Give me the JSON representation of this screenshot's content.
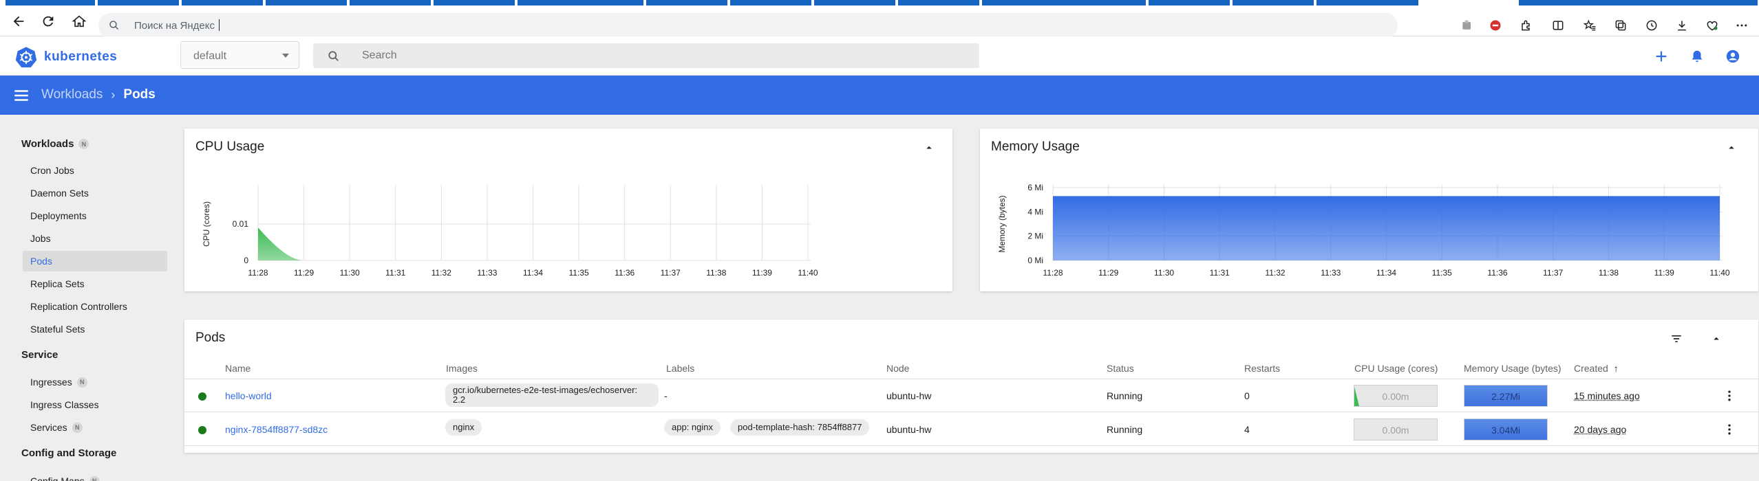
{
  "browser": {
    "address_placeholder": "Поиск на Яндекс"
  },
  "header": {
    "logo_text": "kubernetes",
    "namespace": "default",
    "search_placeholder": "Search"
  },
  "toolbar": {
    "breadcrumb_parent": "Workloads",
    "breadcrumb_separator": "›",
    "breadcrumb_current": "Pods"
  },
  "sidebar": {
    "sections": [
      {
        "label": "Workloads",
        "badge": "N"
      },
      {
        "label": "Service"
      },
      {
        "label": "Config and Storage"
      }
    ],
    "workloads_items": [
      "Cron Jobs",
      "Daemon Sets",
      "Deployments",
      "Jobs",
      "Pods",
      "Replica Sets",
      "Replication Controllers",
      "Stateful Sets"
    ],
    "service_items": [
      {
        "label": "Ingresses",
        "badge": "N"
      },
      {
        "label": "Ingress Classes"
      },
      {
        "label": "Services",
        "badge": "N"
      }
    ],
    "config_items": [
      {
        "label": "Config Maps",
        "badge": "N"
      }
    ],
    "active": "Pods"
  },
  "cpu_card": {
    "title": "CPU Usage"
  },
  "memory_card": {
    "title": "Memory Usage"
  },
  "chart_data": [
    {
      "type": "area",
      "title": "CPU Usage",
      "ylabel": "CPU (cores)",
      "x": [
        "11:28",
        "11:29",
        "11:30",
        "11:31",
        "11:32",
        "11:33",
        "11:34",
        "11:35",
        "11:36",
        "11:37",
        "11:38",
        "11:39",
        "11:40"
      ],
      "y_ticks": [
        "0.01",
        "0"
      ],
      "ylim": [
        0,
        0.02
      ],
      "series": [
        {
          "values": [
            0.009,
            0,
            0,
            0,
            0,
            0,
            0,
            0,
            0,
            0,
            0,
            0,
            0
          ],
          "color": "#3cba54"
        }
      ],
      "grid": true
    },
    {
      "type": "area",
      "title": "Memory Usage",
      "ylabel": "Memory (bytes)",
      "x": [
        "11:28",
        "11:29",
        "11:30",
        "11:31",
        "11:32",
        "11:33",
        "11:34",
        "11:35",
        "11:36",
        "11:37",
        "11:38",
        "11:39",
        "11:40"
      ],
      "y_ticks": [
        "6 Mi",
        "4 Mi",
        "2 Mi",
        "0 Mi"
      ],
      "ylim": [
        0,
        6
      ],
      "series": [
        {
          "values": [
            5.3,
            5.3,
            5.3,
            5.3,
            5.3,
            5.3,
            5.3,
            5.3,
            5.3,
            5.3,
            5.3,
            5.3,
            5.3
          ],
          "color": "#326ce5"
        }
      ],
      "grid": true
    }
  ],
  "pods": {
    "title": "Pods",
    "columns": [
      "Name",
      "Images",
      "Labels",
      "Node",
      "Status",
      "Restarts",
      "CPU Usage (cores)",
      "Memory Usage (bytes)",
      "Created"
    ],
    "sort_indicator": "↑",
    "rows": [
      {
        "name": "hello-world",
        "image": "gcr.io/kubernetes-e2e-test-images/echoserver: 2.2",
        "labels_text": "-",
        "labels": [],
        "node": "ubuntu-hw",
        "status": "Running",
        "restarts": "0",
        "cpu": "0.00m",
        "memory": "2.27Mi",
        "memory_fraction": 1.0,
        "created": "15 minutes ago"
      },
      {
        "name": "nginx-7854ff8877-sd8zc",
        "image": "nginx",
        "labels_text": "",
        "labels": [
          "app: nginx",
          "pod-template-hash: 7854ff8877"
        ],
        "node": "ubuntu-hw",
        "status": "Running",
        "restarts": "4",
        "cpu": "0.00m",
        "memory": "3.04Mi",
        "memory_fraction": 1.0,
        "created": "20 days ago"
      }
    ]
  },
  "colors": {
    "brand": "#326ce5",
    "running": "#1b7a1b",
    "cpu_area": "#3cba54"
  }
}
